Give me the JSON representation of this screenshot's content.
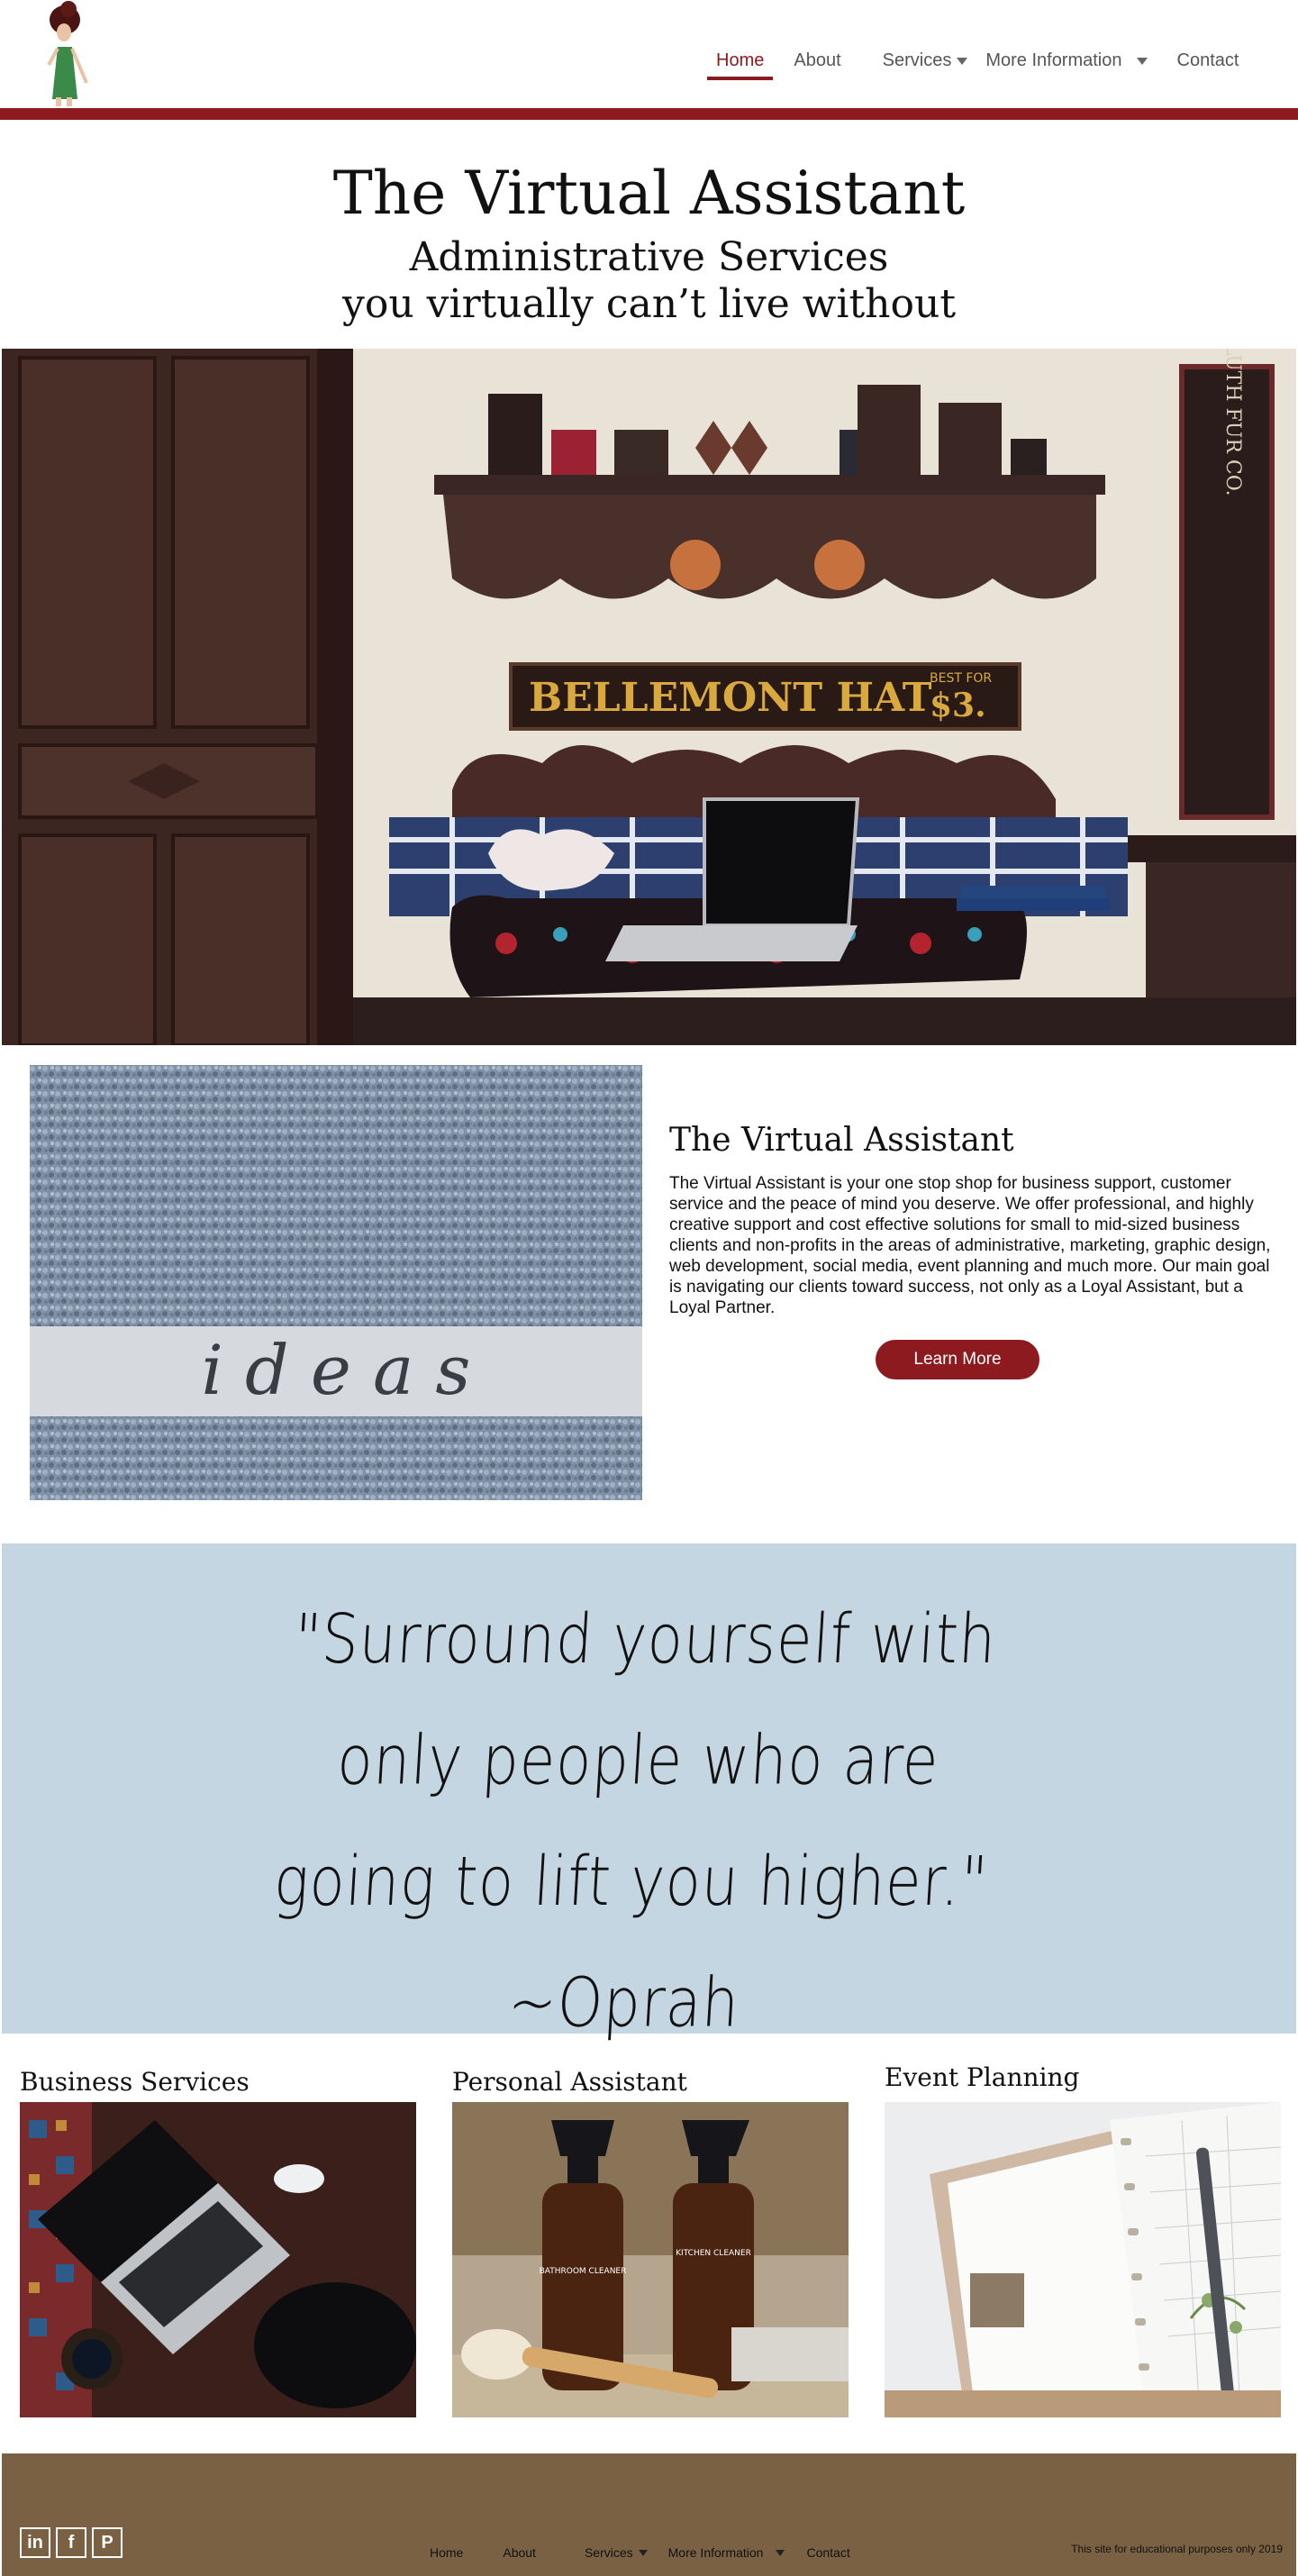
{
  "header": {
    "nav": [
      "Home",
      "About",
      "Services",
      "More Information",
      "Contact"
    ],
    "active": "Home",
    "accent": "#8c1a1f"
  },
  "hero": {
    "title": "The Virtual Assistant",
    "subtitle_1": "Administrative Services",
    "subtitle_2": "you virtually can’t live without",
    "sign_text": "BELLEMONT HAT",
    "sign_price": "$3.",
    "sign_best_for": "BEST FOR",
    "side_sign": "DULUTH FUR CO."
  },
  "intro": {
    "ideas_word": "i d e a s",
    "heading": "The Virtual Assistant",
    "body": "The Virtual Assistant is your one stop shop for business support, customer service and the peace of mind you deserve. We offer professional, and highly creative support and cost effective solutions for small to mid-sized business clients and non-profits in the areas of administrative, marketing, graphic design, web development, social media, event planning and much more. Our main goal is navigating our clients toward success, not only as a Loyal Assistant, but a Loyal Partner.",
    "button": "Learn More"
  },
  "quote": {
    "line_1": "\"Surround yourself with",
    "line_2": "only people who are",
    "line_3": "going to lift you higher.\"",
    "line_4": "~Oprah",
    "bg": "#c4d6e1"
  },
  "services": [
    {
      "title": "Business Services"
    },
    {
      "title": "Personal Assistant",
      "label_1": "BATHROOM CLEANER",
      "label_2": "KITCHEN CLEANER"
    },
    {
      "title": "Event Planning"
    }
  ],
  "footer": {
    "social": [
      "linkedin-icon",
      "facebook-icon",
      "pinterest-icon"
    ],
    "social_glyphs": [
      "in",
      "f",
      "P"
    ],
    "nav": [
      "Home",
      "About",
      "Services",
      "More Information",
      "Contact"
    ],
    "note": "This site for educational purposes only 2019",
    "bg": "#7a6143"
  }
}
